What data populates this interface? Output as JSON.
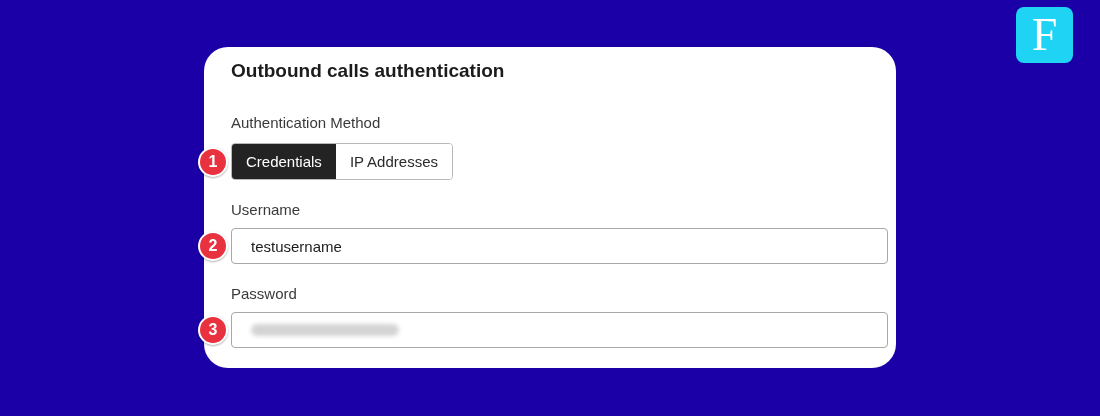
{
  "logo": {
    "letter": "F"
  },
  "card": {
    "title": "Outbound calls authentication",
    "method": {
      "label": "Authentication Method",
      "badge": "1",
      "options": [
        {
          "label": "Credentials",
          "selected": true
        },
        {
          "label": "IP Addresses",
          "selected": false
        }
      ]
    },
    "username": {
      "label": "Username",
      "badge": "2",
      "value": "testusername"
    },
    "password": {
      "label": "Password",
      "badge": "3",
      "value_blurred": true
    }
  }
}
